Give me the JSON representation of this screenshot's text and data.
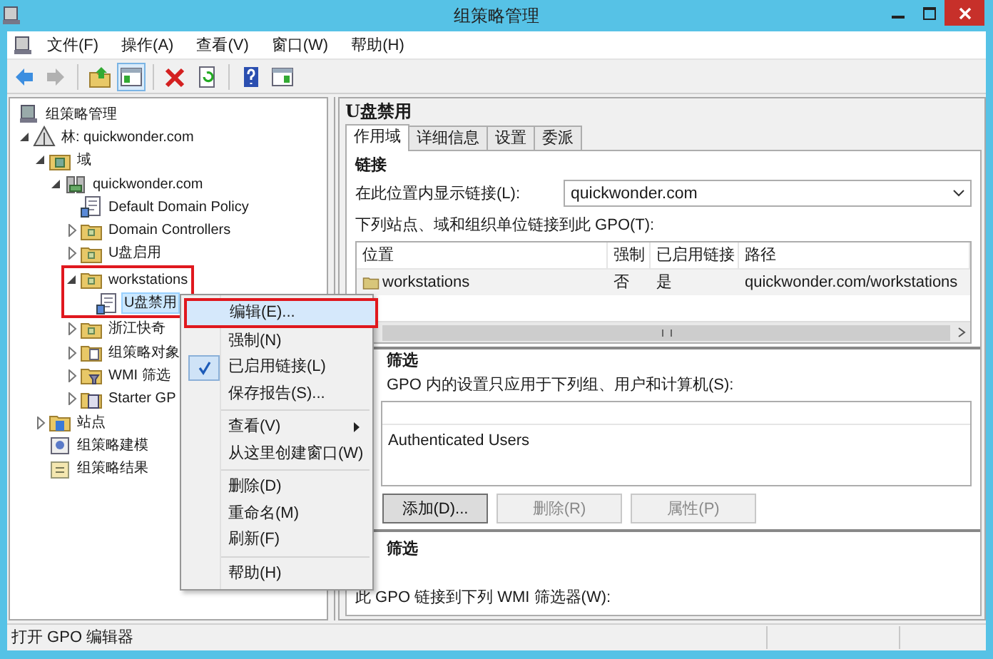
{
  "window": {
    "title": "组策略管理"
  },
  "menu_bar": [
    "文件(F)",
    "操作(A)",
    "查看(V)",
    "窗口(W)",
    "帮助(H)"
  ],
  "toolbar": [
    {
      "kind": "back",
      "disabled": false
    },
    {
      "kind": "forward",
      "disabled": true
    },
    {
      "kind": "separator"
    },
    {
      "kind": "up",
      "disabled": false
    },
    {
      "kind": "tree",
      "disabled": false,
      "selected": true
    },
    {
      "kind": "separator"
    },
    {
      "kind": "delete",
      "disabled": false
    },
    {
      "kind": "refresh",
      "disabled": false
    },
    {
      "kind": "separator"
    },
    {
      "kind": "help",
      "disabled": false
    },
    {
      "kind": "view",
      "disabled": false
    }
  ],
  "tree": {
    "items": [
      {
        "label": "组策略管理",
        "kind": "console",
        "selected": false,
        "children": [
          {
            "label": "林: quickwonder.com",
            "kind": "forest",
            "expanded": true,
            "selected": false,
            "children": [
              {
                "label": "域",
                "kind": "domains",
                "expanded": true,
                "selected": false,
                "children": [
                  {
                    "label": "quickwonder.com",
                    "kind": "domain",
                    "expanded": true,
                    "selected": false,
                    "children": [
                      {
                        "label": "Default Domain Policy",
                        "kind": "gpo",
                        "selected": false
                      },
                      {
                        "label": "Domain Controllers",
                        "kind": "ou",
                        "expanded": false,
                        "selected": false
                      },
                      {
                        "label": "U盘启用",
                        "kind": "ou",
                        "expanded": false,
                        "selected": false
                      },
                      {
                        "label": "workstations",
                        "kind": "ou",
                        "expanded": true,
                        "selected": false,
                        "highlighted": true,
                        "children": [
                          {
                            "label": "U盘禁用",
                            "kind": "gpo",
                            "selected": true
                          }
                        ]
                      },
                      {
                        "label": "浙江快奇",
                        "kind": "ou",
                        "expanded": false,
                        "selected": false
                      },
                      {
                        "label": "组策略对象",
                        "kind": "gpo-folder",
                        "expanded": false,
                        "selected": false
                      },
                      {
                        "label": "WMI 筛选",
                        "kind": "wmi-folder",
                        "expanded": false,
                        "selected": false
                      },
                      {
                        "label": "Starter GP",
                        "kind": "starter-folder",
                        "expanded": false,
                        "selected": false
                      }
                    ]
                  }
                ]
              },
              {
                "label": "站点",
                "kind": "sites",
                "expanded": false,
                "selected": false
              },
              {
                "label": "组策略建模",
                "kind": "modeling",
                "selected": false
              },
              {
                "label": "组策略结果",
                "kind": "results",
                "selected": false
              }
            ]
          }
        ]
      }
    ]
  },
  "context_menu": [
    {
      "kind": "item",
      "label": "编辑(E)...",
      "highlighted": true,
      "checked": false,
      "submenu": false
    },
    {
      "kind": "item",
      "label": "强制(N)",
      "highlighted": false,
      "checked": false,
      "submenu": false
    },
    {
      "kind": "item",
      "label": "已启用链接(L)",
      "highlighted": false,
      "checked": true,
      "submenu": false
    },
    {
      "kind": "item",
      "label": "保存报告(S)...",
      "highlighted": false,
      "checked": false,
      "submenu": false
    },
    {
      "kind": "separator"
    },
    {
      "kind": "item",
      "label": "查看(V)",
      "highlighted": false,
      "checked": false,
      "submenu": true
    },
    {
      "kind": "item",
      "label": "从这里创建窗口(W)",
      "highlighted": false,
      "checked": false,
      "submenu": false
    },
    {
      "kind": "separator"
    },
    {
      "kind": "item",
      "label": "删除(D)",
      "highlighted": false,
      "checked": false,
      "submenu": false
    },
    {
      "kind": "item",
      "label": "重命名(M)",
      "highlighted": false,
      "checked": false,
      "submenu": false
    },
    {
      "kind": "item",
      "label": "刷新(F)",
      "highlighted": false,
      "checked": false,
      "submenu": false
    },
    {
      "kind": "separator"
    },
    {
      "kind": "item",
      "label": "帮助(H)",
      "highlighted": false,
      "checked": false,
      "submenu": false
    }
  ],
  "details": {
    "title": "U盘禁用",
    "tabs": [
      {
        "label": "作用域",
        "selected": true
      },
      {
        "label": "详细信息",
        "selected": false
      },
      {
        "label": "设置",
        "selected": false
      },
      {
        "label": "委派",
        "selected": false
      }
    ],
    "links": {
      "heading": "链接",
      "location_label": "在此位置内显示链接(L):",
      "location_value": "quickwonder.com",
      "list_label": "下列站点、域和组织单位链接到此 GPO(T):",
      "columns": [
        "位置",
        "强制",
        "已启用链接",
        "路径"
      ],
      "rows": [
        {
          "cells": [
            "workstations",
            "否",
            "是",
            "quickwonder.com/workstations"
          ]
        }
      ]
    },
    "security_filtering": {
      "heading": "筛选",
      "description": "GPO 内的设置只应用于下列组、用户和计算机(S):",
      "items": [
        "Authenticated Users"
      ],
      "buttons": [
        {
          "label": "添加(D)...",
          "disabled": false
        },
        {
          "label": "删除(R)",
          "disabled": true
        },
        {
          "label": "属性(P)",
          "disabled": true
        }
      ]
    },
    "wmi_filtering": {
      "heading": "筛选",
      "description": "此 GPO 链接到下列 WMI 筛选器(W):"
    }
  },
  "status_bar": "打开 GPO 编辑器"
}
